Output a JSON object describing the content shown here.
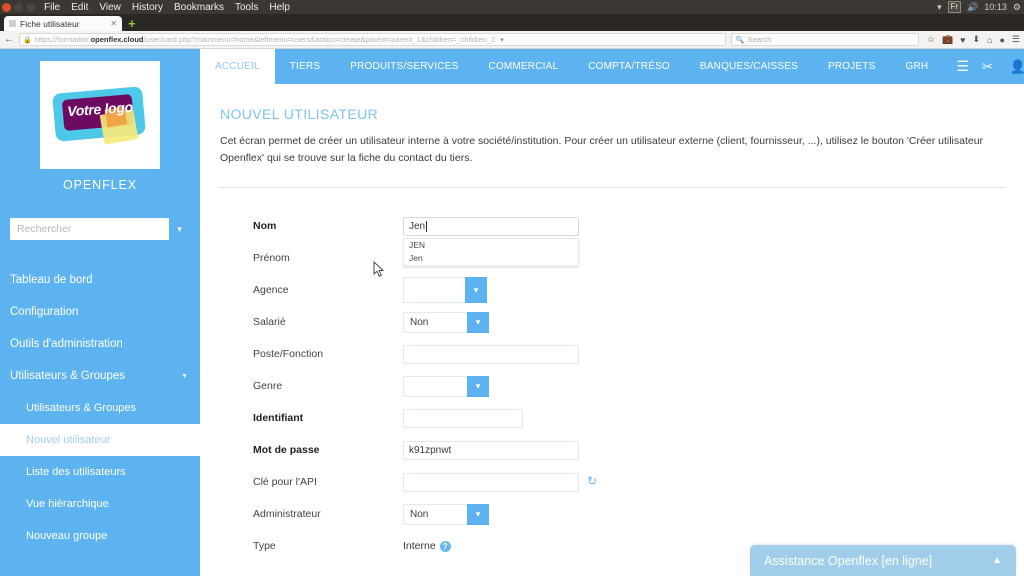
{
  "os": {
    "menus": [
      "File",
      "Edit",
      "View",
      "History",
      "Bookmarks",
      "Tools",
      "Help"
    ],
    "tray": {
      "wifi_icon": "wifi-icon",
      "keyboard_layout": "Fr",
      "volume_icon": "volume-icon",
      "clock": "10:13",
      "settings_icon": "gear-icon"
    }
  },
  "browser": {
    "tab": {
      "title": "Fiche utilisateur",
      "close_icon": "close-icon",
      "favicon": "page-favicon"
    },
    "new_tab_label": "+",
    "back_icon": "back-arrow-icon",
    "lock_icon": "lock-icon",
    "url": {
      "scheme": "https://formation.",
      "domain": "openflex.cloud",
      "path": "/user/card.php?mainmenu=home&leftmenu=users&action=create&parent=parent_1&children=_children_2"
    },
    "url_dropdown_icon": "chevron-down-icon",
    "search": {
      "placeholder": "Search",
      "icon": "search-icon"
    },
    "toolbar_icons": [
      "star-icon",
      "save-to-pocket-icon",
      "pocket-icon",
      "download-icon",
      "home-icon",
      "account-icon",
      "menu-icon"
    ]
  },
  "sidebar": {
    "logo": {
      "text": "Votre logo",
      "alt": "logo-placeholder"
    },
    "brand": "OPENFLEX",
    "search": {
      "placeholder": "Rechercher",
      "dropdown_icon": "chevron-down-icon"
    },
    "items": [
      {
        "label": "Tableau de bord",
        "level": "top",
        "active": false,
        "expandable": false
      },
      {
        "label": "Configuration",
        "level": "top",
        "active": false,
        "expandable": false
      },
      {
        "label": "Outils d'administration",
        "level": "top",
        "active": false,
        "expandable": false
      },
      {
        "label": "Utilisateurs & Groupes",
        "level": "top",
        "active": false,
        "expandable": true
      },
      {
        "label": "Utilisateurs & Groupes",
        "level": "sub",
        "active": false,
        "expandable": false
      },
      {
        "label": "Nouvel utilisateur",
        "level": "sub",
        "active": true,
        "expandable": false
      },
      {
        "label": "Liste des utilisateurs",
        "level": "sub",
        "active": false,
        "expandable": false
      },
      {
        "label": "Vue hiérarchique",
        "level": "sub",
        "active": false,
        "expandable": false
      },
      {
        "label": "Nouveau groupe",
        "level": "sub",
        "active": false,
        "expandable": false
      }
    ]
  },
  "topnav": {
    "items": [
      {
        "label": "ACCUEIL",
        "active": true
      },
      {
        "label": "TIERS",
        "active": false
      },
      {
        "label": "PRODUITS/SERVICES",
        "active": false
      },
      {
        "label": "COMMERCIAL",
        "active": false
      },
      {
        "label": "COMPTA/TRÉSO",
        "active": false
      },
      {
        "label": "BANQUES/CAISSES",
        "active": false
      },
      {
        "label": "PROJETS",
        "active": false
      },
      {
        "label": "GRH",
        "active": false
      }
    ],
    "burger_icon": "hamburger-menu-icon",
    "right_icons": [
      "tools-icon",
      "user-icon",
      "printer-icon",
      "power-icon"
    ]
  },
  "page": {
    "title": "NOUVEL UTILISATEUR",
    "description": "Cet écran permet de créer un utilisateur interne à votre société/institution. Pour créer un utilisateur externe (client, fournisseur, ...), utilisez le bouton 'Créer utilisateur Openflex' qui se trouve sur la fiche du contact du tiers."
  },
  "form": {
    "fields": [
      {
        "label": "Nom",
        "bold": true,
        "type": "text",
        "value": "Jen",
        "focused": true
      },
      {
        "label": "Prénom",
        "bold": false,
        "type": "text",
        "value": "",
        "focused": false
      },
      {
        "label": "Agence",
        "bold": false,
        "type": "select",
        "value": ""
      },
      {
        "label": "Salarié",
        "bold": false,
        "type": "select",
        "value": "Non"
      },
      {
        "label": "Poste/Fonction",
        "bold": false,
        "type": "text",
        "value": ""
      },
      {
        "label": "Genre",
        "bold": false,
        "type": "select",
        "value": ""
      },
      {
        "label": "Identifiant",
        "bold": true,
        "type": "text",
        "value": ""
      },
      {
        "label": "Mot de passe",
        "bold": true,
        "type": "text",
        "value": "k91zpnwt"
      },
      {
        "label": "Clé pour l'API",
        "bold": false,
        "type": "text-refresh",
        "value": "",
        "refresh_icon": "refresh-icon"
      },
      {
        "label": "Administrateur",
        "bold": false,
        "type": "select",
        "value": "Non"
      },
      {
        "label": "Type",
        "bold": false,
        "type": "static",
        "value": "Interne",
        "help_icon": "help-icon"
      }
    ],
    "autocomplete": {
      "for_field": "Nom",
      "options": [
        "JEN",
        "Jen"
      ]
    }
  },
  "chat": {
    "title": "Assistance Openflex [en ligne]",
    "collapse_icon": "chevron-up-icon"
  },
  "colors": {
    "accent": "#5cb3f0",
    "title": "#7fc3ef",
    "chat": "#9fcdea"
  }
}
